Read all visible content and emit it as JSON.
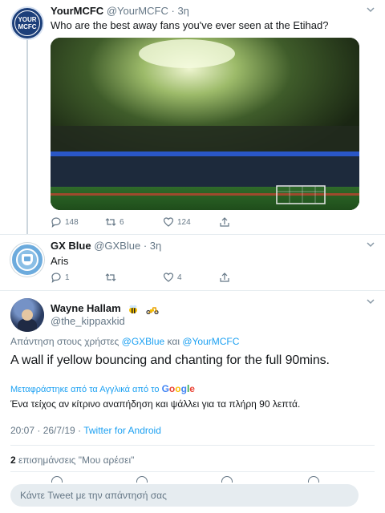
{
  "tweet1": {
    "display_name": "YourMCFC",
    "handle": "@YourMCFC",
    "time": "3η",
    "avatar_text": "YOUR MCFC",
    "text": "Who are the best away fans you've ever seen at the Etihad?",
    "media_alt": "stadium-photo",
    "replies": "148",
    "retweets": "6",
    "likes": "124"
  },
  "tweet2": {
    "display_name": "GX Blue",
    "handle": "@GXBlue",
    "time": "3η",
    "text": "Aris",
    "replies": "1",
    "likes": "4"
  },
  "tweet3": {
    "display_name": "Wayne Hallam",
    "handle": "@the_kippaxkid",
    "reply_prefix": "Απάντηση στους χρήστες",
    "reply_user1": "@GXBlue",
    "reply_conj": "και",
    "reply_user2": "@YourMCFC",
    "text": "A wall if yellow bouncing and chanting for the full  90mins.",
    "translate_label": "Μεταφράστηκε από τα Αγγλικά από το",
    "translated_text": "Ένα τείχος αν κίτρινο αναπήδηση και ψάλλει για τα πλήρη 90 λεπτά.",
    "timestamp": "20:07 · 26/7/19 · ",
    "client": "Twitter for Android",
    "likes_count": "2",
    "likes_label": "επισημάνσεις \"Μου αρέσει\""
  },
  "google": [
    "G",
    "o",
    "o",
    "g",
    "l",
    "e"
  ],
  "compose": {
    "placeholder": "Κάντε Tweet με την απάντησή σας"
  },
  "colors": {
    "accent": "#1da1f2",
    "muted": "#657786",
    "text": "#14171a"
  }
}
